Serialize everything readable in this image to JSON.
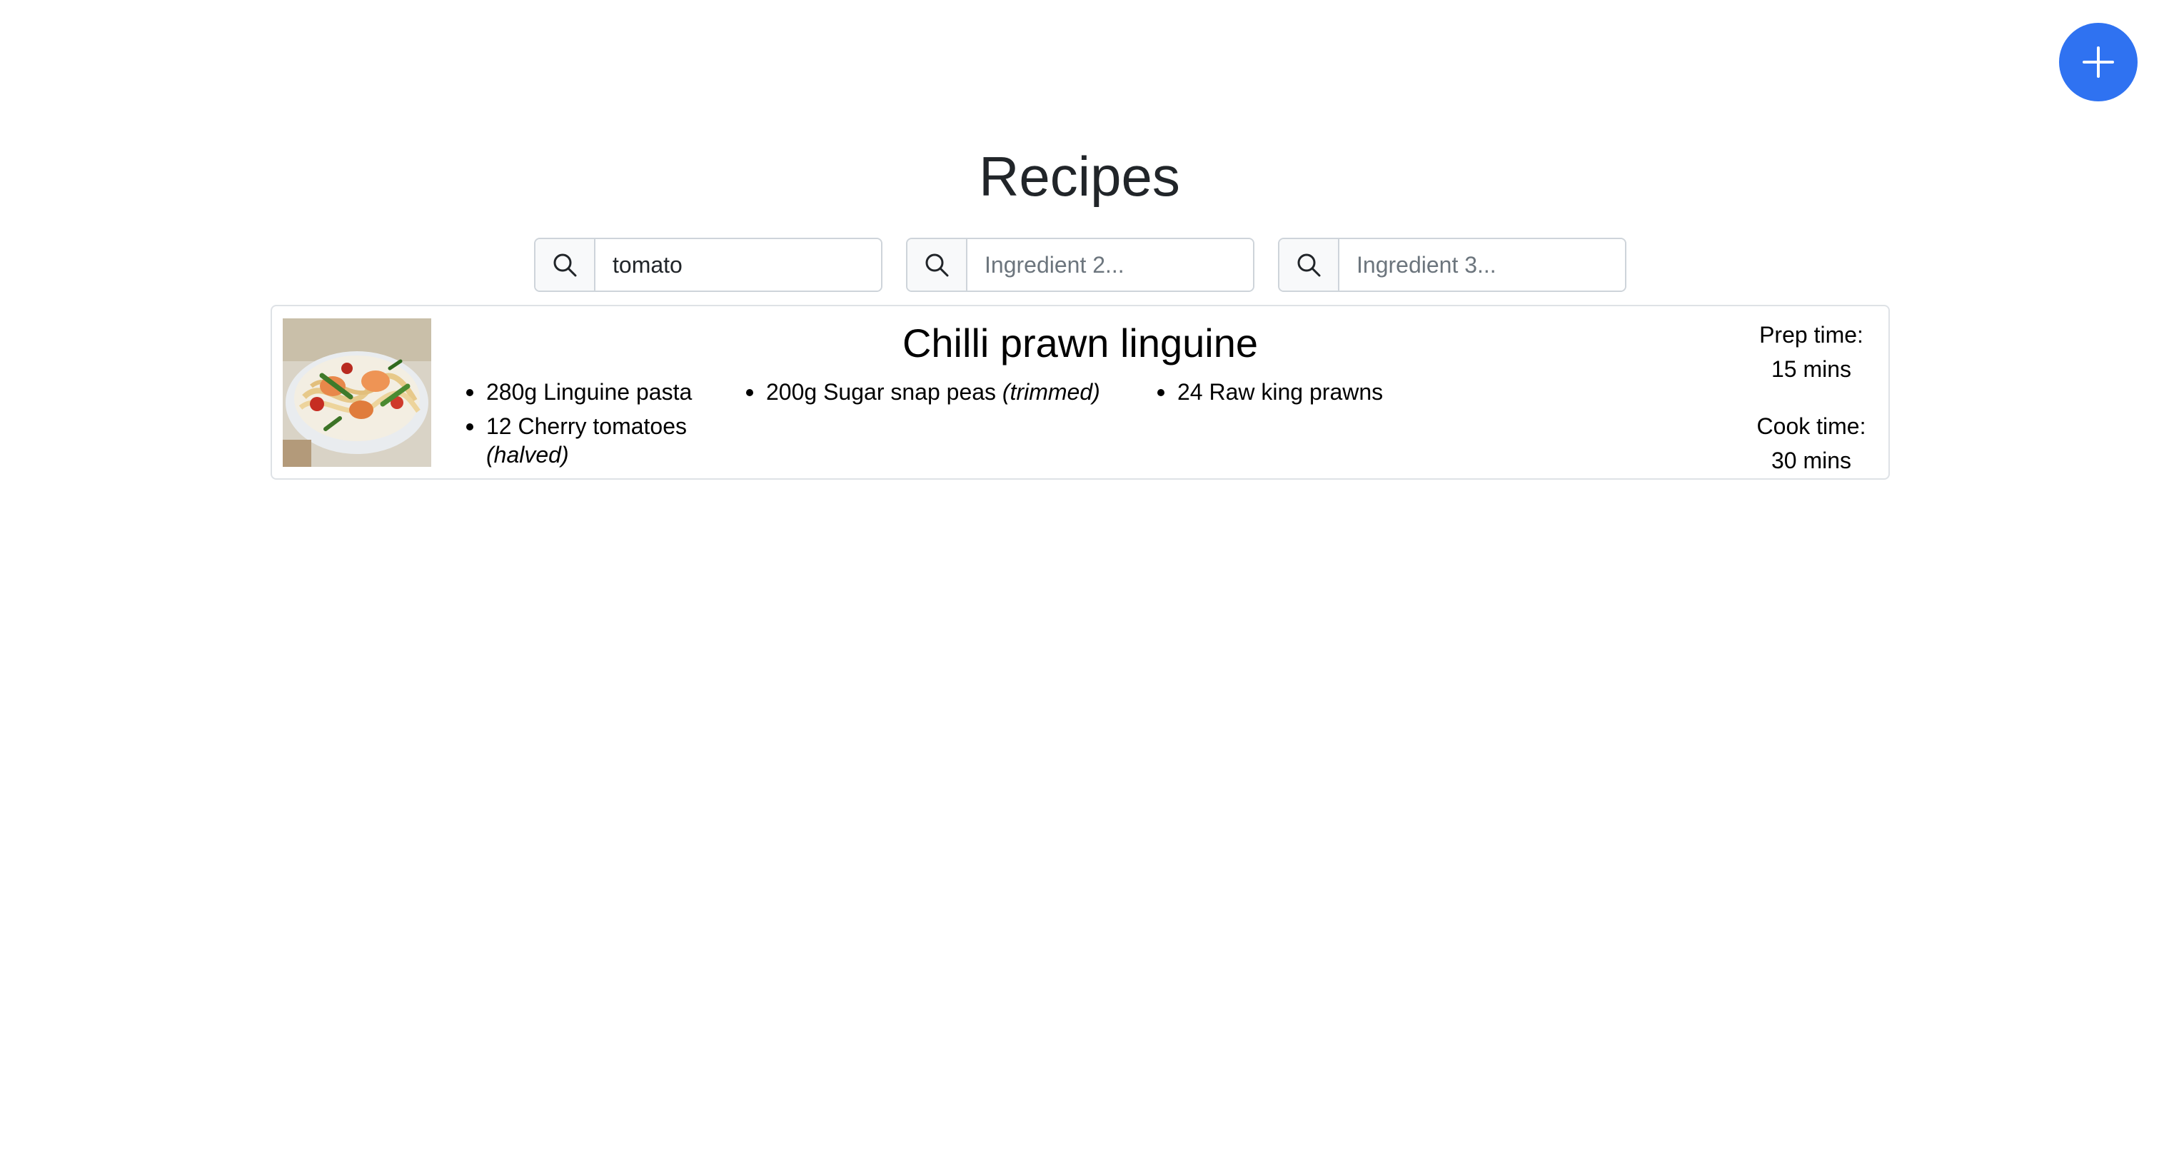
{
  "header": {
    "title": "Recipes",
    "add_button_icon": "plus-icon"
  },
  "colors": {
    "accent": "#2f72f1",
    "border": "#ced4da",
    "text": "#212529",
    "placeholder": "#6c757d"
  },
  "search": {
    "fields": [
      {
        "value": "tomato",
        "placeholder": "",
        "icon": "search-icon"
      },
      {
        "value": "",
        "placeholder": "Ingredient 2...",
        "icon": "search-icon"
      },
      {
        "value": "",
        "placeholder": "Ingredient 3...",
        "icon": "search-icon"
      }
    ]
  },
  "recipes": [
    {
      "title": "Chilli prawn linguine",
      "image_icon": "pasta-dish-photo",
      "ingredients": [
        {
          "text": "280g Linguine pasta",
          "note": ""
        },
        {
          "text": "200g Sugar snap peas",
          "note": "(trimmed)"
        },
        {
          "text": "24 Raw king prawns",
          "note": ""
        },
        {
          "text": "12 Cherry tomatoes",
          "note": "(halved)"
        }
      ],
      "prep_label": "Prep time:",
      "prep_value": "15 mins",
      "cook_label": "Cook time:",
      "cook_value": "30 mins"
    }
  ]
}
